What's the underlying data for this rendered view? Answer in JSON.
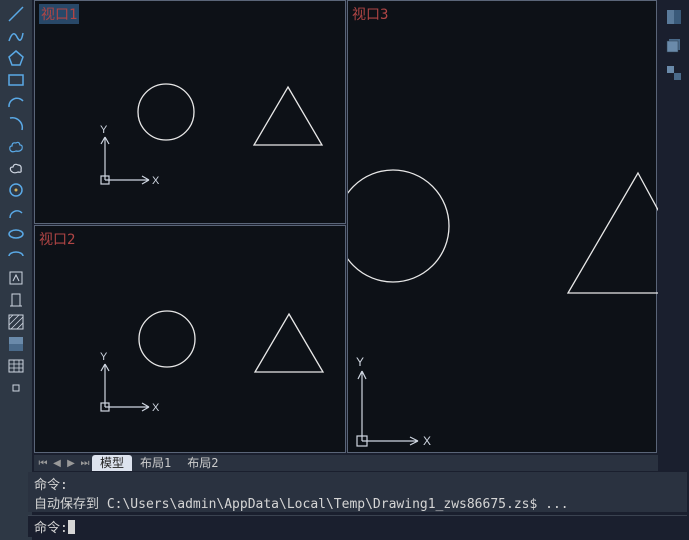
{
  "viewports": {
    "vp1": {
      "label": "视口1",
      "xaxis": "X",
      "yaxis": "Y"
    },
    "vp2": {
      "label": "视口2",
      "xaxis": "X",
      "yaxis": "Y"
    },
    "vp3": {
      "label": "视口3",
      "xaxis": "X",
      "yaxis": "Y"
    }
  },
  "tabs": {
    "model": "模型",
    "layout1": "布局1",
    "layout2": "布局2"
  },
  "command": {
    "history_line1": "命令:",
    "history_line2": "自动保存到 C:\\Users\\admin\\AppData\\Local\\Temp\\Drawing1_zws86675.zs$ ...",
    "prompt": "命令:"
  },
  "toolbar_left": {
    "items": [
      "line",
      "spline",
      "polygon",
      "rectangle",
      "arc",
      "arc2",
      "revision-cloud",
      "cloud",
      "circle",
      "arc3",
      "ellipse",
      "ellipse-arc",
      "insert-block",
      "create-block",
      "hatch",
      "gradient",
      "table",
      "point"
    ]
  },
  "toolbar_right": {
    "items": [
      "properties",
      "layers",
      "tool-palettes"
    ]
  },
  "window_controls": {
    "minimize": "−",
    "restore": "❐",
    "close": "✕"
  },
  "colors": {
    "bg": "#0d1117",
    "panel": "#2a3240",
    "toolbar": "#2e3845",
    "vp_label": "#b04545",
    "stroke": "#e8e8e8",
    "accent_blue": "#5aa9e6"
  }
}
